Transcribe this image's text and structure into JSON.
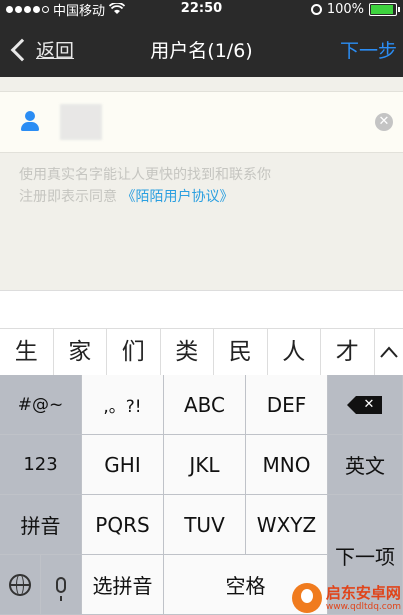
{
  "status_bar": {
    "carrier": "中国移动",
    "time": "22:50",
    "battery": "100%",
    "battery_level": 1.0
  },
  "nav": {
    "back_label": "返回",
    "title": "用户名(1/6)",
    "next_label": "下一步"
  },
  "form": {
    "hint_line1": "使用真实名字能让人更快的找到和联系你",
    "hint_line2_prefix": "注册即表示同意",
    "agreement_link": "《陌陌用户协议》"
  },
  "candidates": [
    "生",
    "家",
    "们",
    "类",
    "民",
    "人",
    "才"
  ],
  "keyboard": {
    "symbols": "#@~",
    "punct": ",。?!",
    "abc": "ABC",
    "def": "DEF",
    "num": "123",
    "ghi": "GHI",
    "jkl": "JKL",
    "mno": "MNO",
    "english": "英文",
    "pinyin": "拼音",
    "pqrs": "PQRS",
    "tuv": "TUV",
    "wxyz": "WXYZ",
    "next_item": "下一项",
    "select_pinyin": "选拼音",
    "space": "空格"
  },
  "watermark": {
    "name": "启东安卓网",
    "url": "www.qdltdq.com"
  },
  "colors": {
    "accent": "#2b8df4",
    "link": "#2b9fe0"
  }
}
